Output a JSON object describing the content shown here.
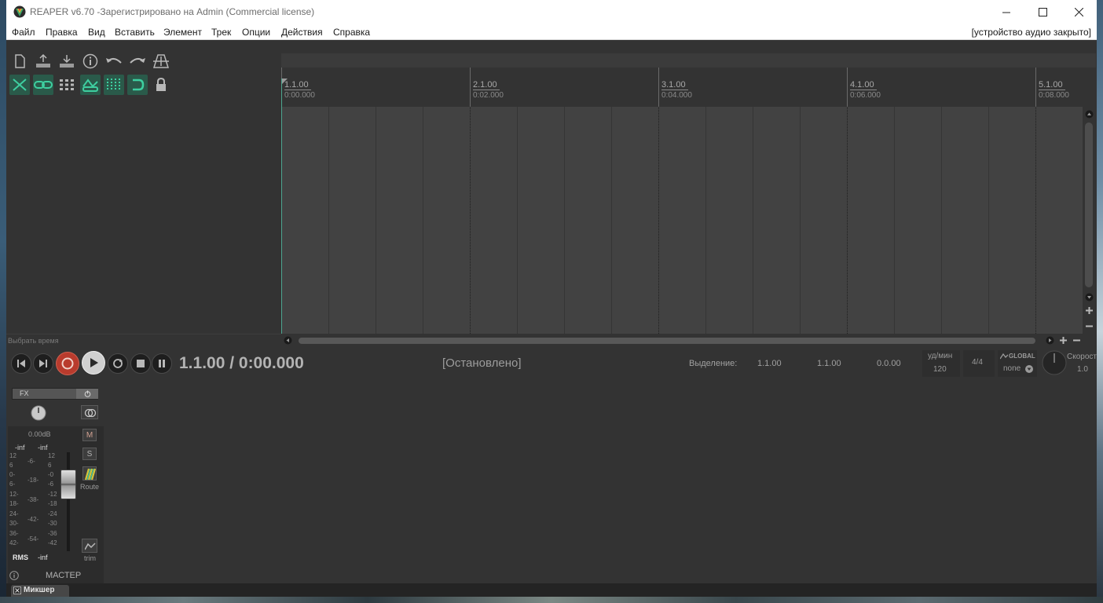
{
  "window": {
    "title": "REAPER v6.70 -Зарегистрировано на Admin (Commercial license)",
    "controls": [
      "minimize",
      "maximize",
      "close"
    ]
  },
  "menu": {
    "items": [
      "Файл",
      "Правка",
      "Вид",
      "Вставить",
      "Элемент",
      "Трек",
      "Опции",
      "Действия",
      "Справка"
    ],
    "audio_status": "[устройство аудио закрыто]"
  },
  "toolbar": {
    "row1": [
      "new-project-icon",
      "save-upload-icon",
      "save-download-icon",
      "info-icon",
      "undo-icon",
      "redo-icon",
      "metronome-icon"
    ],
    "row2": [
      "ripple-edit-icon",
      "link-icon",
      "grid-icon",
      "envelope-link-icon",
      "snap-grid-icon",
      "loop-icon",
      "lock-icon"
    ]
  },
  "tcp": {
    "select_time_label": "Выбрать время"
  },
  "ruler": {
    "markers": [
      {
        "bar": "1.1.00",
        "time": "0:00.000"
      },
      {
        "bar": "2.1.00",
        "time": "0:02.000"
      },
      {
        "bar": "3.1.00",
        "time": "0:04.000"
      },
      {
        "bar": "4.1.00",
        "time": "0:06.000"
      },
      {
        "bar": "5.1.00",
        "time": "0:08.000"
      }
    ]
  },
  "transport": {
    "position": "1.1.00 / 0:00.000",
    "state": "[Остановлено]",
    "selection_label": "Выделение:",
    "selection_start": "1.1.00",
    "selection_end": "1.1.00",
    "selection_length": "0.0.00",
    "bpm_label": "уд/мин",
    "bpm_value": "120",
    "time_signature": "4/4",
    "global_label": "GLOBAL",
    "global_value": "none",
    "rate_label": "Скорост",
    "rate_value": "1.0"
  },
  "mixer": {
    "fx_label": "FX",
    "volume_db": "0.00dB",
    "peak_left": "-inf",
    "peak_right": "-inf",
    "scale_left": [
      "12",
      "6",
      "0-",
      "6-",
      "12-",
      "18-",
      "24-",
      "30-",
      "36-",
      "42-"
    ],
    "scale_mid": [
      "-6-",
      "-18-",
      "-38-",
      "-42-",
      "-54-"
    ],
    "scale_right": [
      "12",
      "6",
      "-0",
      "-6",
      "-12",
      "-18",
      "-24",
      "-30",
      "-36",
      "-42"
    ],
    "mute_label": "M",
    "solo_label": "S",
    "route_label": "Route",
    "trim_label": "trim",
    "rms_label": "RMS",
    "rms_value": "-inf",
    "master_name": "МАСТЕР",
    "tab_label": "Микшер"
  },
  "colors": {
    "accent": "#4da58f",
    "record": "#c0392b",
    "background": "#333333",
    "arrange": "#424242"
  }
}
